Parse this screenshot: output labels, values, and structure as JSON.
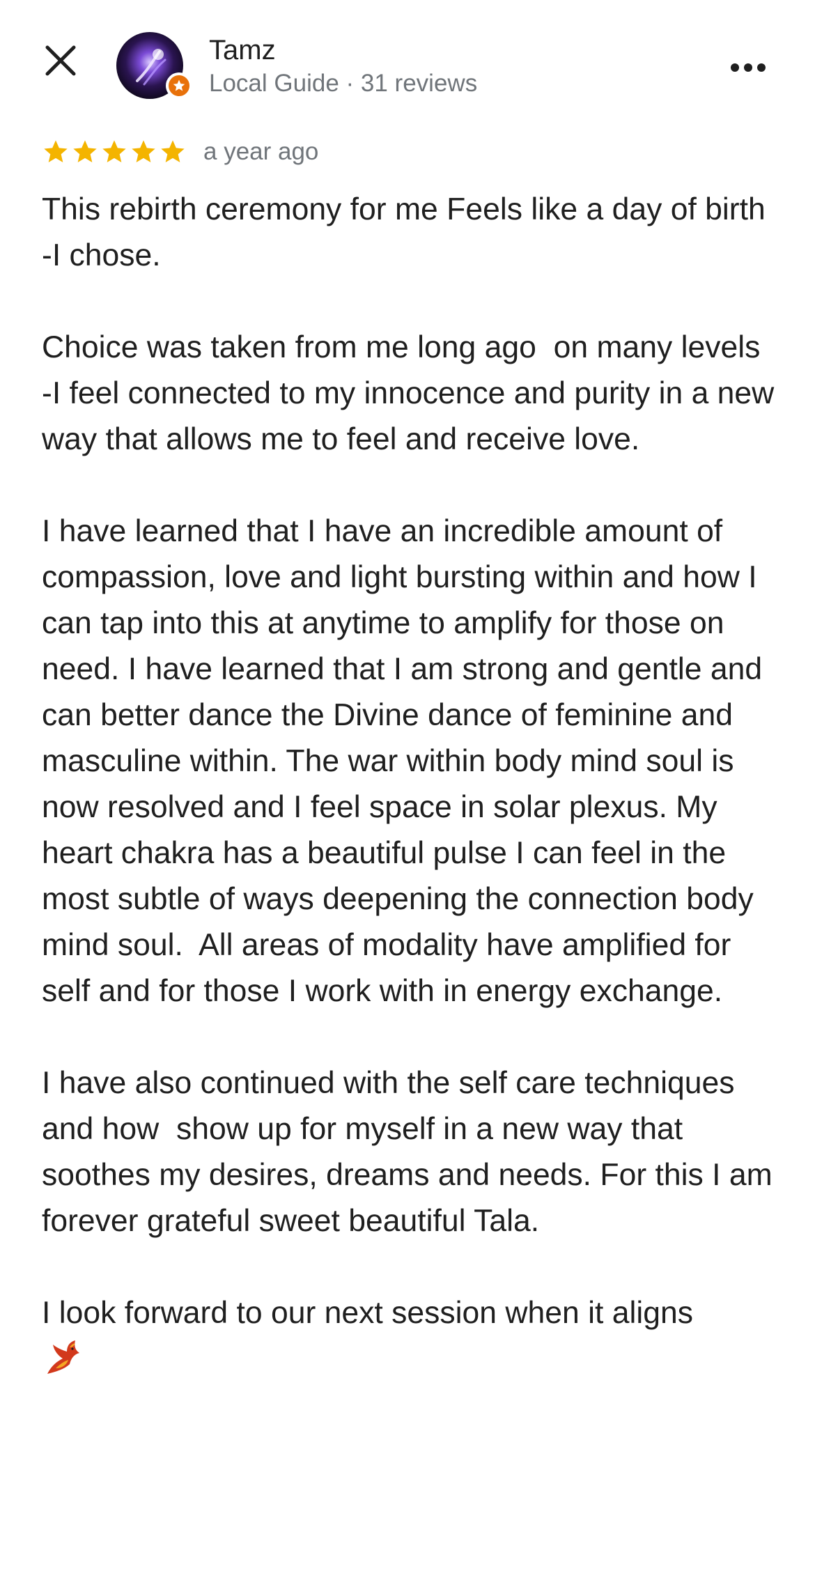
{
  "reviewer": {
    "name": "Tamz",
    "meta": "Local Guide · 31 reviews",
    "avatar_icon": "purple-light-avatar",
    "badge_icon": "local-guide-star-badge"
  },
  "rating": {
    "stars": 5,
    "max_stars": 5,
    "date": "a year ago",
    "star_color": "#f4b400"
  },
  "review": {
    "paragraphs": [
      "This rebirth ceremony for me Feels like a day of birth -I chose.",
      "Choice was taken from me long ago  on many levels   -I feel connected to my innocence and purity in a new way that allows me to feel and receive love.",
      "I have learned that I have an incredible amount of compassion, love and light bursting within and how I can tap into this at anytime to amplify for those on need. I have learned that I am strong and gentle and can better dance the Divine dance of feminine and masculine within. The war within body mind soul is now resolved and I feel space in solar plexus. My heart chakra has a beautiful pulse I can feel in the most subtle of ways deepening the connection body mind soul.  All areas of modality have amplified for self and for those I work with in energy exchange.",
      "I have also continued with the self care techniques  and how  show up for myself in a new way that soothes my desires, dreams and needs. For this I am forever grateful sweet beautiful Tala.",
      "I look forward to our next session when it aligns"
    ],
    "trailing_emoji": "phoenix-emoji"
  },
  "controls": {
    "close_icon": "close-icon",
    "more_icon": "more-horizontal-icon"
  },
  "colors": {
    "text_primary": "#1f1f1f",
    "text_secondary": "#70757a",
    "badge": "#e8710a"
  }
}
